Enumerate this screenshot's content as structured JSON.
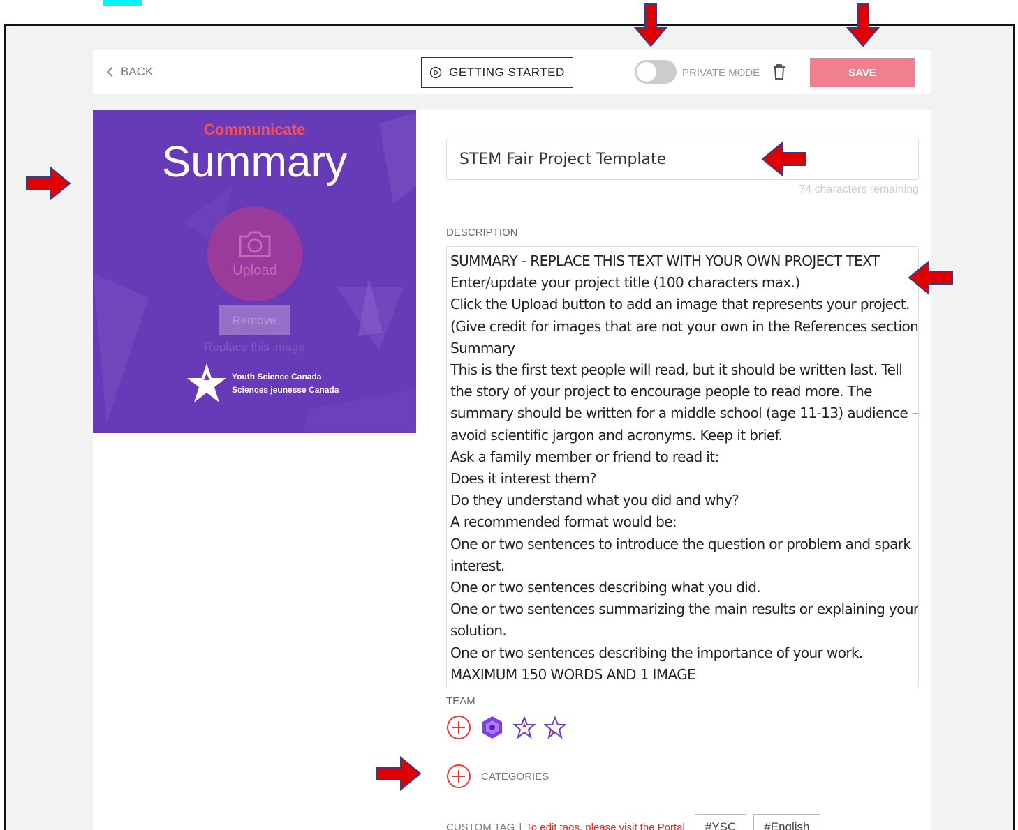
{
  "topbar": {
    "back_label": "BACK",
    "getting_started_label": "GETTING STARTED",
    "private_mode_label": "PRIVATE MODE",
    "private_mode_on": false,
    "save_label": "SAVE"
  },
  "cover": {
    "kicker": "Communicate",
    "title": "Summary",
    "upload_label": "Upload",
    "remove_label": "Remove",
    "replace_hint": "Replace this image",
    "logo_line1": "Youth Science Canada",
    "logo_line2": "Sciences jeunesse Canada"
  },
  "project": {
    "title_value": "STEM Fair Project Template",
    "chars_remaining": "74 characters remaining",
    "description_label": "DESCRIPTION",
    "description_lines": [
      "SUMMARY - REPLACE THIS TEXT WITH YOUR OWN PROJECT TEXT",
      "Enter/update your project title (100 characters max.)",
      "Click the Upload button to add an image that represents your project.",
      "(Give credit for images that are not your own in the References section.)",
      "Summary",
      "This is the first text people will read, but it should be written last. Tell",
      "the story of your project to encourage people to read more. The",
      "summary should be written for a middle school (age 11-13) audience –",
      "avoid scientific jargon and acronyms. Keep it brief.",
      "Ask a family member or friend to read it:",
      "Does it interest them?",
      "Do they understand what you did and why?",
      "A recommended format would be:",
      "One or two sentences to introduce the question or problem and spark",
      "interest.",
      "One or two sentences describing what you did.",
      "One or two sentences summarizing the main results or explaining your",
      "solution.",
      "One or two sentences describing the importance of your work.",
      "MAXIMUM 150 WORDS AND 1 IMAGE"
    ],
    "team_label": "TEAM",
    "categories_label": "CATEGORIES",
    "custom_tag_label": "CUSTOM TAG",
    "custom_tag_separator": "|",
    "custom_tag_hint": "To edit tags, please visit the Portal",
    "tags": [
      "#YSC",
      "#English"
    ]
  },
  "colors": {
    "accent_pink": "#f08090",
    "cover_purple": "#673ab7",
    "annotation_red": "#e00000",
    "highlight_cyan": "#00f5ff"
  }
}
